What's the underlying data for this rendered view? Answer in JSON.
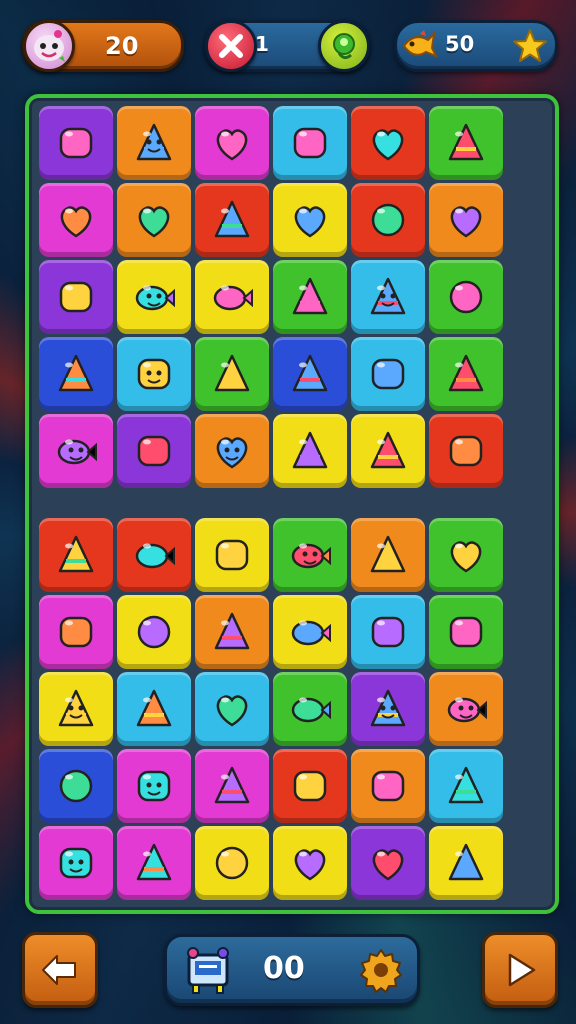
{
  "hud": {
    "left_counter": "20",
    "lives_counter": "1",
    "stars_counter": "50"
  },
  "bottom": {
    "score": "00"
  },
  "colors": {
    "purple": "#8a36d8",
    "orange": "#f08a1c",
    "magenta": "#e23ad3",
    "cyan": "#33bde8",
    "red": "#e4371e",
    "green": "#3fc22b",
    "yellow": "#f2de17",
    "blue": "#2b4ed8",
    "pink": "#e63aa4",
    "board_border": "#3ec13b"
  },
  "board_top": [
    [
      {
        "c": "purple",
        "icon": "grapes-icon"
      },
      {
        "c": "orange",
        "icon": "green-cube-face-icon"
      },
      {
        "c": "magenta",
        "icon": "fish-candy-icon"
      },
      {
        "c": "cyan",
        "icon": "ice-cream-cone-icon"
      },
      {
        "c": "red",
        "icon": "swirl-icon"
      },
      {
        "c": "green",
        "icon": "heart-candy-icon"
      }
    ],
    [
      {
        "c": "magenta",
        "icon": "note-paper-icon"
      },
      {
        "c": "orange",
        "icon": "green-pepper-icon"
      },
      {
        "c": "red",
        "icon": "lemon-icon"
      },
      {
        "c": "yellow",
        "icon": "lollipop-icon"
      },
      {
        "c": "red",
        "icon": "bone-icon"
      },
      {
        "c": "orange",
        "icon": "ring-key-icon"
      }
    ],
    [
      {
        "c": "purple",
        "icon": "carrot-cone-icon"
      },
      {
        "c": "yellow",
        "icon": "octopus-icon"
      },
      {
        "c": "yellow",
        "icon": "blue-blob-icon"
      },
      {
        "c": "green",
        "icon": "ring-icon"
      },
      {
        "c": "cyan",
        "icon": "green-blob-face-icon"
      },
      {
        "c": "green",
        "icon": "planet-icon"
      }
    ],
    [
      {
        "c": "blue",
        "icon": "snail-icon"
      },
      {
        "c": "cyan",
        "icon": "orange-fruit-face-icon"
      },
      {
        "c": "green",
        "icon": "wrapped-candy-icon"
      },
      {
        "c": "blue",
        "icon": "carrot-icon"
      },
      {
        "c": "cyan",
        "icon": "red-ball-icon"
      },
      {
        "c": "green",
        "icon": "magnifier-icon"
      }
    ],
    [
      {
        "c": "magenta",
        "icon": "green-apple-face-icon"
      },
      {
        "c": "purple",
        "icon": "grape-stick-icon"
      },
      {
        "c": "orange",
        "icon": "strawberry-face-icon"
      },
      {
        "c": "yellow",
        "icon": "blue-drop-icon"
      },
      {
        "c": "yellow",
        "icon": "blue-lollipop-icon"
      },
      {
        "c": "red",
        "icon": "lifebuoy-icon"
      }
    ]
  ],
  "board_bottom": [
    [
      {
        "c": "red",
        "icon": "green-swirl-icon"
      },
      {
        "c": "red",
        "icon": "purple-leaf-icon"
      },
      {
        "c": "yellow",
        "icon": "purple-bubble-icon"
      },
      {
        "c": "green",
        "icon": "sun-face-icon"
      },
      {
        "c": "orange",
        "icon": "crossed-tools-icon"
      },
      {
        "c": "green",
        "icon": "red-spiral-icon"
      }
    ],
    [
      {
        "c": "magenta",
        "icon": "yellow-fish-icon"
      },
      {
        "c": "yellow",
        "icon": "dotted-egg-icon"
      },
      {
        "c": "orange",
        "icon": "yellow-bun-icon"
      },
      {
        "c": "yellow",
        "icon": "green-wrapped-candy-icon"
      },
      {
        "c": "cyan",
        "icon": "rainbow-cone-icon"
      },
      {
        "c": "green",
        "icon": "ice-cream-cone-icon"
      }
    ],
    [
      {
        "c": "yellow",
        "icon": "orange-sun-face-icon"
      },
      {
        "c": "cyan",
        "icon": "purple-grapes-icon"
      },
      {
        "c": "cyan",
        "icon": "rocket-icon"
      },
      {
        "c": "green",
        "icon": "yellow-candy-icon"
      },
      {
        "c": "purple",
        "icon": "yellow-slime-face-icon"
      },
      {
        "c": "orange",
        "icon": "monster-box-icon"
      }
    ],
    [
      {
        "c": "blue",
        "icon": "pink-blob-icon"
      },
      {
        "c": "magenta",
        "icon": "orange-cookie-face-icon"
      },
      {
        "c": "magenta",
        "icon": "green-fish-icon"
      },
      {
        "c": "red",
        "icon": "pencil-candy-icon"
      },
      {
        "c": "orange",
        "icon": "pink-bird-icon"
      },
      {
        "c": "cyan",
        "icon": "pink-heart-icon"
      }
    ],
    [
      {
        "c": "magenta",
        "icon": "yellow-sun-face-icon"
      },
      {
        "c": "magenta",
        "icon": "moon-badge-icon"
      },
      {
        "c": "yellow",
        "icon": "camera-icon"
      },
      {
        "c": "yellow",
        "icon": "blue-candy-icon"
      },
      {
        "c": "purple",
        "icon": "jellyfish-icon"
      },
      {
        "c": "yellow",
        "icon": "feather-egg-icon"
      }
    ]
  ]
}
